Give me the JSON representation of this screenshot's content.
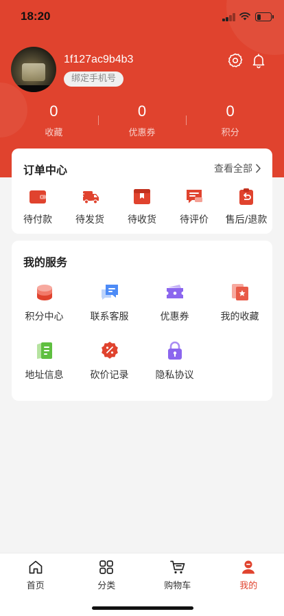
{
  "status_bar": {
    "time": "18:20",
    "battery_level": 0.3,
    "signal_bars": 2
  },
  "profile": {
    "username": "1f127ac9b4b3",
    "bind_phone_label": "绑定手机号",
    "settings_icon": "gear-icon",
    "notification_icon": "bell-icon"
  },
  "stats": [
    {
      "value": "0",
      "label": "收藏"
    },
    {
      "value": "0",
      "label": "优惠券"
    },
    {
      "value": "0",
      "label": "积分"
    }
  ],
  "orders": {
    "title": "订单中心",
    "view_all": "查看全部",
    "items": [
      {
        "label": "待付款",
        "icon": "wallet-icon"
      },
      {
        "label": "待发货",
        "icon": "truck-icon"
      },
      {
        "label": "待收货",
        "icon": "package-icon"
      },
      {
        "label": "待评价",
        "icon": "review-icon"
      },
      {
        "label": "售后/退款",
        "icon": "refund-icon"
      }
    ]
  },
  "services": {
    "title": "我的服务",
    "items": [
      {
        "label": "积分中心",
        "icon": "coins-icon"
      },
      {
        "label": "联系客服",
        "icon": "chat-icon"
      },
      {
        "label": "优惠券",
        "icon": "coupon-icon"
      },
      {
        "label": "我的收藏",
        "icon": "favorite-icon"
      },
      {
        "label": "地址信息",
        "icon": "address-icon"
      },
      {
        "label": "砍价记录",
        "icon": "discount-icon"
      },
      {
        "label": "隐私协议",
        "icon": "lock-icon"
      }
    ]
  },
  "tabbar": {
    "items": [
      {
        "label": "首页",
        "icon": "home-icon",
        "active": false
      },
      {
        "label": "分类",
        "icon": "grid-icon",
        "active": false
      },
      {
        "label": "购物车",
        "icon": "cart-icon",
        "active": false
      },
      {
        "label": "我的",
        "icon": "user-icon",
        "active": true
      }
    ]
  },
  "colors": {
    "brand": "#e0432e",
    "background": "#f4f4f4",
    "card": "#ffffff"
  }
}
